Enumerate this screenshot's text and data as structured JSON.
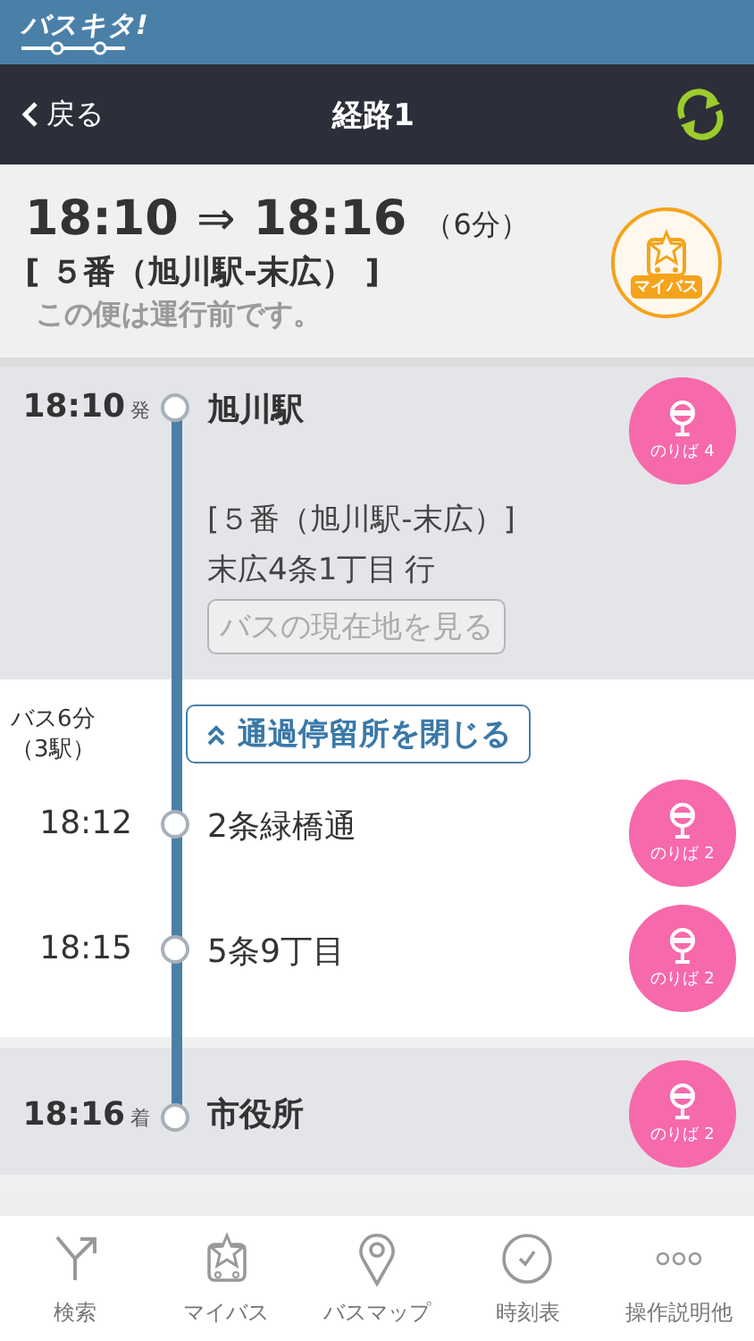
{
  "header": {
    "logo": "バスキタ!"
  },
  "nav": {
    "back": "戻る",
    "title": "経路1"
  },
  "summary": {
    "depart": "18:10",
    "arrow": "⇒",
    "arrive": "18:16",
    "duration": "（6分）",
    "route": "[ ５番（旭川駅-末広） ]",
    "notice": "この便は運行前です。",
    "mybus_label": "マイバス"
  },
  "stops": [
    {
      "kind": "depart",
      "time": "18:10",
      "suffix": "発",
      "name": "旭川駅",
      "platform": "のりば 4",
      "route": "[５番（旭川駅-末広）]",
      "destination": "末広4条1丁目",
      "destination_suffix": "行",
      "locate_button": "バスの現在地を見る"
    },
    {
      "kind": "transit",
      "duration": "バス6分",
      "stations": "（3駅）",
      "toggle": "通過停留所を閉じる"
    },
    {
      "kind": "pass",
      "time": "18:12",
      "name": "2条緑橋通",
      "platform": "のりば 2"
    },
    {
      "kind": "pass",
      "time": "18:15",
      "name": "5条9丁目",
      "platform": "のりば 2"
    },
    {
      "kind": "arrive",
      "time": "18:16",
      "suffix": "着",
      "name": "市役所",
      "platform": "のりば 2"
    }
  ],
  "tabs": [
    {
      "label": "検索",
      "selected": false
    },
    {
      "label": "マイバス",
      "selected": false
    },
    {
      "label": "バスマップ",
      "selected": false
    },
    {
      "label": "時刻表",
      "selected": false
    },
    {
      "label": "操作説明他",
      "selected": false
    }
  ]
}
